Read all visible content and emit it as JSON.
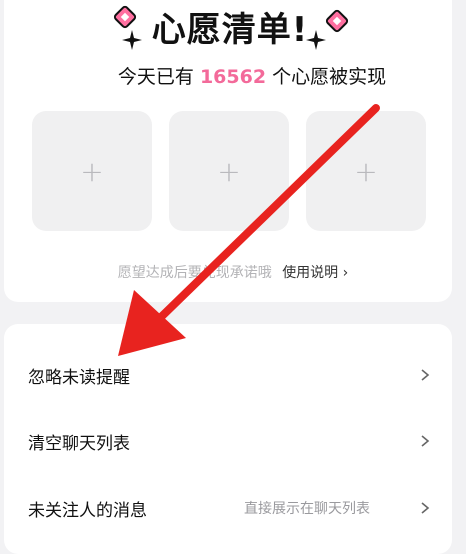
{
  "wish": {
    "title": "心愿清单!",
    "subtitle_prefix": "今天已有",
    "subtitle_count": "16562",
    "subtitle_suffix": "个心愿被实现",
    "slot_glyph": "+",
    "hint_text": "愿望达成后要兑现承诺哦",
    "hint_link": "使用说明 ›"
  },
  "settings": {
    "rows": [
      {
        "label": "忽略未读提醒",
        "value": ""
      },
      {
        "label": "清空聊天列表",
        "value": ""
      },
      {
        "label": "未关注人的消息",
        "value": "直接展示在聊天列表"
      }
    ]
  },
  "colors": {
    "accent": "#f36a9a",
    "arrow": "#e8231f"
  },
  "icons": [
    "sparkle-icon",
    "plus-icon",
    "chevron-right-icon",
    "arrow-annotation-icon"
  ]
}
